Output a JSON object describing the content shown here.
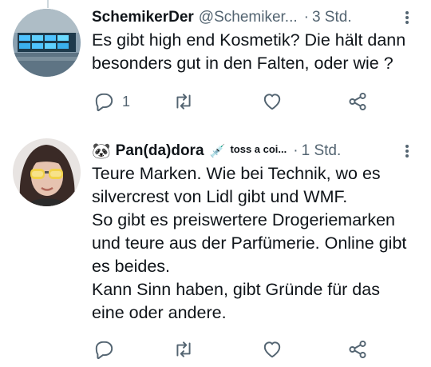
{
  "tweets": [
    {
      "display_name": "SchemikerDer",
      "handle": "@Schemiker...",
      "separator": "·",
      "time": "3 Std.",
      "lines": [
        "Es gibt high end Kosmetik? Die hält dann",
        "besonders gut in den Falten, oder wie ?"
      ],
      "reply_count": "1",
      "icons": {
        "reply": "reply-icon",
        "retweet": "retweet-icon",
        "like": "heart-icon",
        "share": "share-icon",
        "more": "more-icon"
      }
    },
    {
      "emoji_prefix": "🐼",
      "display_name": "Pan(da)dora",
      "emoji_suffix": "💉",
      "bio_snippet": "toss a coi",
      "bio_ellipsis": "...",
      "separator": "·",
      "time": "1 Std.",
      "lines": [
        "Teure Marken. Wie bei Technik, wo es",
        "silvercrest von Lidl gibt und WMF.",
        "So gibt es preiswertere Drogeriemarken",
        "und teure aus der Parfümerie. Online gibt",
        "es beides.",
        "Kann Sinn haben, gibt Gründe für das",
        "eine oder andere."
      ],
      "icons": {
        "reply": "reply-icon",
        "retweet": "retweet-icon",
        "like": "heart-icon",
        "share": "share-icon",
        "more": "more-icon"
      }
    }
  ],
  "colors": {
    "text": "#0f1419",
    "secondary": "#536471",
    "thread_line": "#cfd9de"
  }
}
